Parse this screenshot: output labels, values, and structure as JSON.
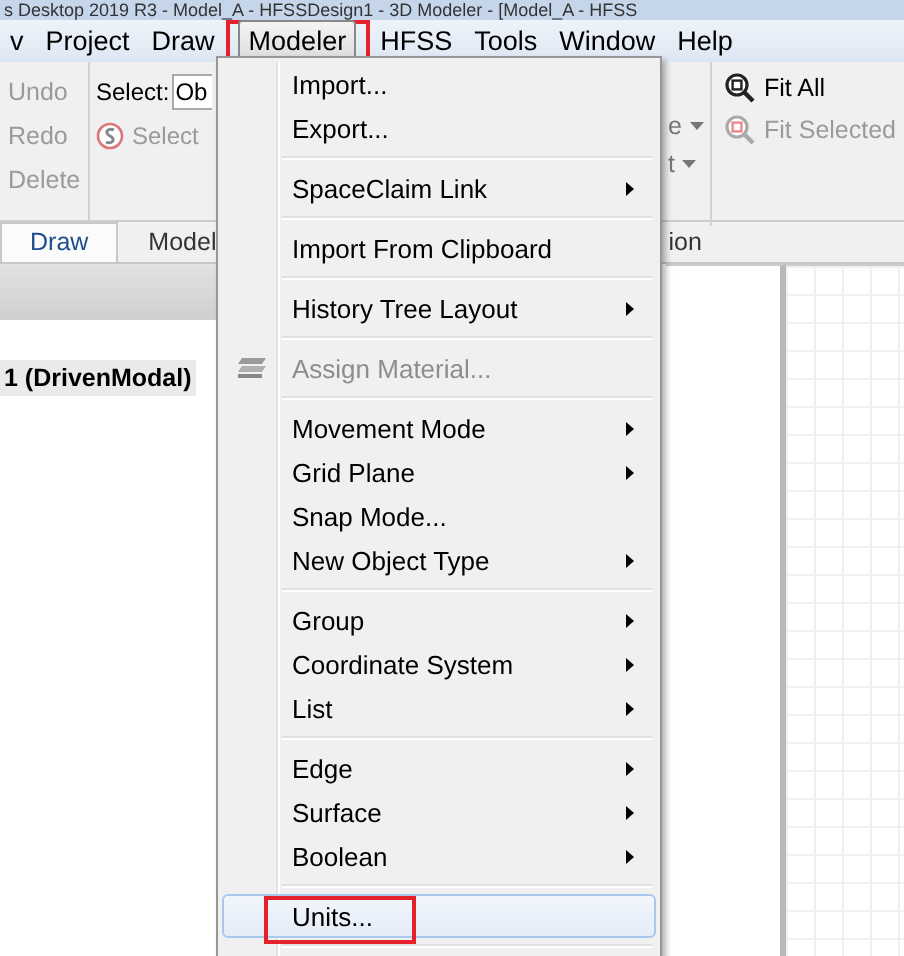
{
  "window": {
    "title": "s Desktop 2019 R3 - Model_A - HFSSDesign1 - 3D Modeler - [Model_A - HFSS"
  },
  "menu_bar": [
    {
      "label": "v",
      "selected": false,
      "annotated": false
    },
    {
      "label": "Project",
      "selected": false,
      "annotated": false
    },
    {
      "label": "Draw",
      "selected": false,
      "annotated": false
    },
    {
      "label": "Modeler",
      "selected": true,
      "annotated": true
    },
    {
      "label": "HFSS",
      "selected": false,
      "annotated": false
    },
    {
      "label": "Tools",
      "selected": false,
      "annotated": false
    },
    {
      "label": "Window",
      "selected": false,
      "annotated": false
    },
    {
      "label": "Help",
      "selected": false,
      "annotated": false
    }
  ],
  "toolbar": {
    "edit_buttons": [
      {
        "label": "Undo",
        "disabled": true
      },
      {
        "label": "Redo",
        "disabled": true
      },
      {
        "label": "Delete",
        "disabled": true
      }
    ],
    "select_label": "Select:",
    "select_value": "Ob",
    "select_button": {
      "label": "Select",
      "disabled": true
    },
    "cut_dropdowns": [
      "e",
      "t"
    ],
    "fit_buttons": [
      {
        "label": "Fit All",
        "disabled": false
      },
      {
        "label": "Fit Selected",
        "disabled": true
      }
    ]
  },
  "ribbon_tabs": [
    {
      "label": "Draw",
      "selected": true
    },
    {
      "label": "Model",
      "selected": false
    },
    {
      "label": "ion",
      "selected": false
    }
  ],
  "project_tree": {
    "item": "1 (DrivenModal)"
  },
  "dropdown_menu": [
    {
      "kind": "item",
      "label": "Import...",
      "submenu": false,
      "disabled": false,
      "highlighted": false,
      "annotated": false
    },
    {
      "kind": "item",
      "label": "Export...",
      "submenu": false,
      "disabled": false,
      "highlighted": false,
      "annotated": false
    },
    {
      "kind": "separator"
    },
    {
      "kind": "item",
      "label": "SpaceClaim Link",
      "submenu": true,
      "disabled": false,
      "highlighted": false,
      "annotated": false
    },
    {
      "kind": "separator"
    },
    {
      "kind": "item",
      "label": "Import From Clipboard",
      "submenu": false,
      "disabled": false,
      "highlighted": false,
      "annotated": false
    },
    {
      "kind": "separator"
    },
    {
      "kind": "item",
      "label": "History Tree Layout",
      "submenu": true,
      "disabled": false,
      "highlighted": false,
      "annotated": false
    },
    {
      "kind": "separator"
    },
    {
      "kind": "icon_item",
      "label": "Assign Material...",
      "submenu": false,
      "disabled": true,
      "highlighted": false,
      "annotated": false
    },
    {
      "kind": "separator"
    },
    {
      "kind": "item",
      "label": "Movement Mode",
      "submenu": true,
      "disabled": false,
      "highlighted": false,
      "annotated": false
    },
    {
      "kind": "item",
      "label": "Grid Plane",
      "submenu": true,
      "disabled": false,
      "highlighted": false,
      "annotated": false
    },
    {
      "kind": "item",
      "label": "Snap Mode...",
      "submenu": false,
      "disabled": false,
      "highlighted": false,
      "annotated": false
    },
    {
      "kind": "item",
      "label": "New Object Type",
      "submenu": true,
      "disabled": false,
      "highlighted": false,
      "annotated": false
    },
    {
      "kind": "separator"
    },
    {
      "kind": "item",
      "label": "Group",
      "submenu": true,
      "disabled": false,
      "highlighted": false,
      "annotated": false
    },
    {
      "kind": "item",
      "label": "Coordinate System",
      "submenu": true,
      "disabled": false,
      "highlighted": false,
      "annotated": false
    },
    {
      "kind": "item",
      "label": "List",
      "submenu": true,
      "disabled": false,
      "highlighted": false,
      "annotated": false
    },
    {
      "kind": "separator"
    },
    {
      "kind": "item",
      "label": "Edge",
      "submenu": true,
      "disabled": false,
      "highlighted": false,
      "annotated": false
    },
    {
      "kind": "item",
      "label": "Surface",
      "submenu": true,
      "disabled": false,
      "highlighted": false,
      "annotated": false
    },
    {
      "kind": "item",
      "label": "Boolean",
      "submenu": true,
      "disabled": false,
      "highlighted": false,
      "annotated": false
    },
    {
      "kind": "separator"
    },
    {
      "kind": "item",
      "label": "Units...",
      "submenu": false,
      "disabled": false,
      "highlighted": true,
      "annotated": true
    },
    {
      "kind": "separator"
    }
  ]
}
